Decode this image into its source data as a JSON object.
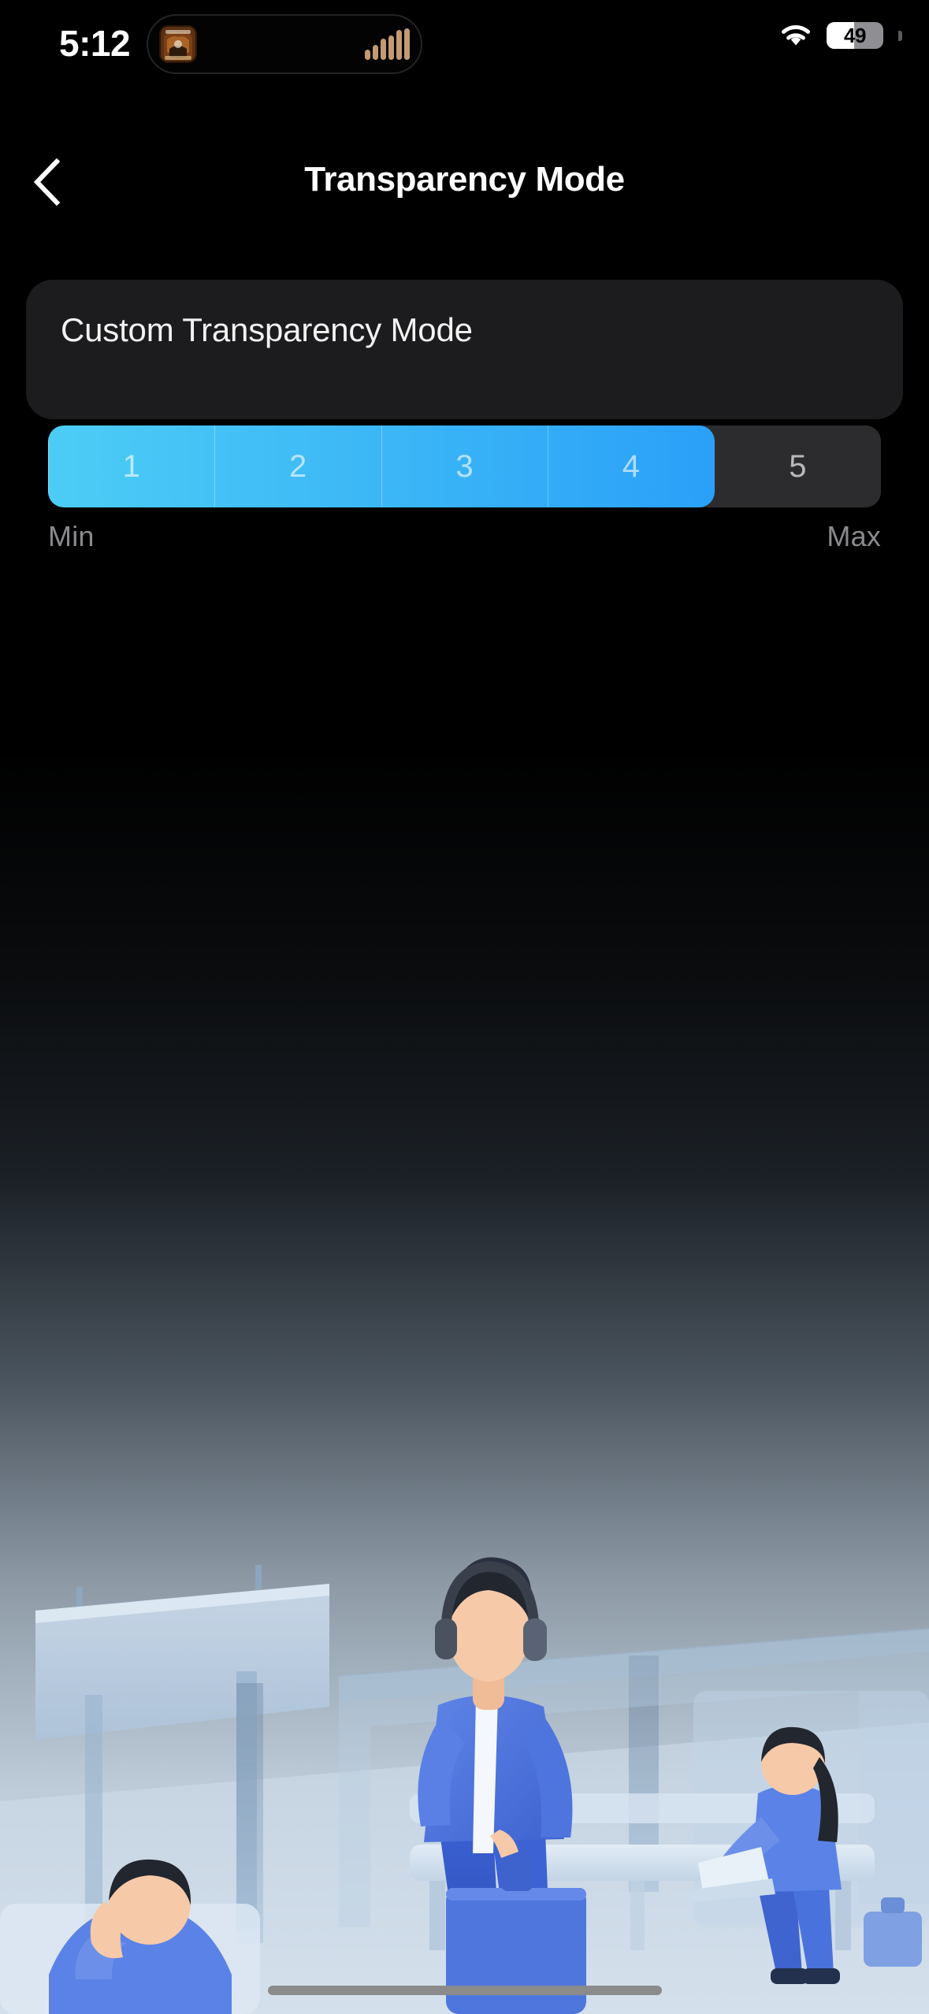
{
  "status_bar": {
    "time": "5:12",
    "dynamic_island": {
      "album_art_icon": "album-artwork-thumbnail",
      "activity_icon": "audio-waveform-icon",
      "waveform_bars": [
        13,
        19,
        27,
        31,
        38,
        40
      ],
      "waveform_color": "#c49a72"
    },
    "wifi_icon": "wifi-icon",
    "battery": {
      "level_label": "49",
      "level_percent": 49,
      "fill_color": "#ffffff",
      "track_color": "#8e8e93"
    }
  },
  "nav": {
    "back_icon": "chevron-left-icon",
    "title": "Transparency Mode"
  },
  "card": {
    "title": "Custom Transparency Mode",
    "background_color": "#1c1c1e",
    "segmented_control": {
      "segments": [
        "1",
        "2",
        "3",
        "4",
        "5"
      ],
      "selected_value": 4,
      "total": 5,
      "fill_percent": 80,
      "gradient_start": "#4ccdf5",
      "gradient_end": "#2aa0f8",
      "track_color": "#2c2c2e"
    },
    "min_label": "Min",
    "max_label": "Max"
  },
  "illustration": {
    "name": "transit-station-scene",
    "description": "People at a transit station, one standing wearing headphones",
    "elements": [
      "billboard-sign",
      "station-pillar",
      "bench",
      "standing-person-with-headphones",
      "seated-person-with-laptop",
      "seated-person-resting",
      "suitcase"
    ],
    "colors": {
      "sky_top": "#000000",
      "sky_bottom": "#d6e3ef",
      "accent_blue": "#4a7fe0",
      "light_blue": "#b9cfe6",
      "skin": "#f6c9a8",
      "hair": "#1f2430"
    }
  },
  "home_indicator": {
    "label": "home-indicator",
    "color": "#8b8b8b"
  }
}
